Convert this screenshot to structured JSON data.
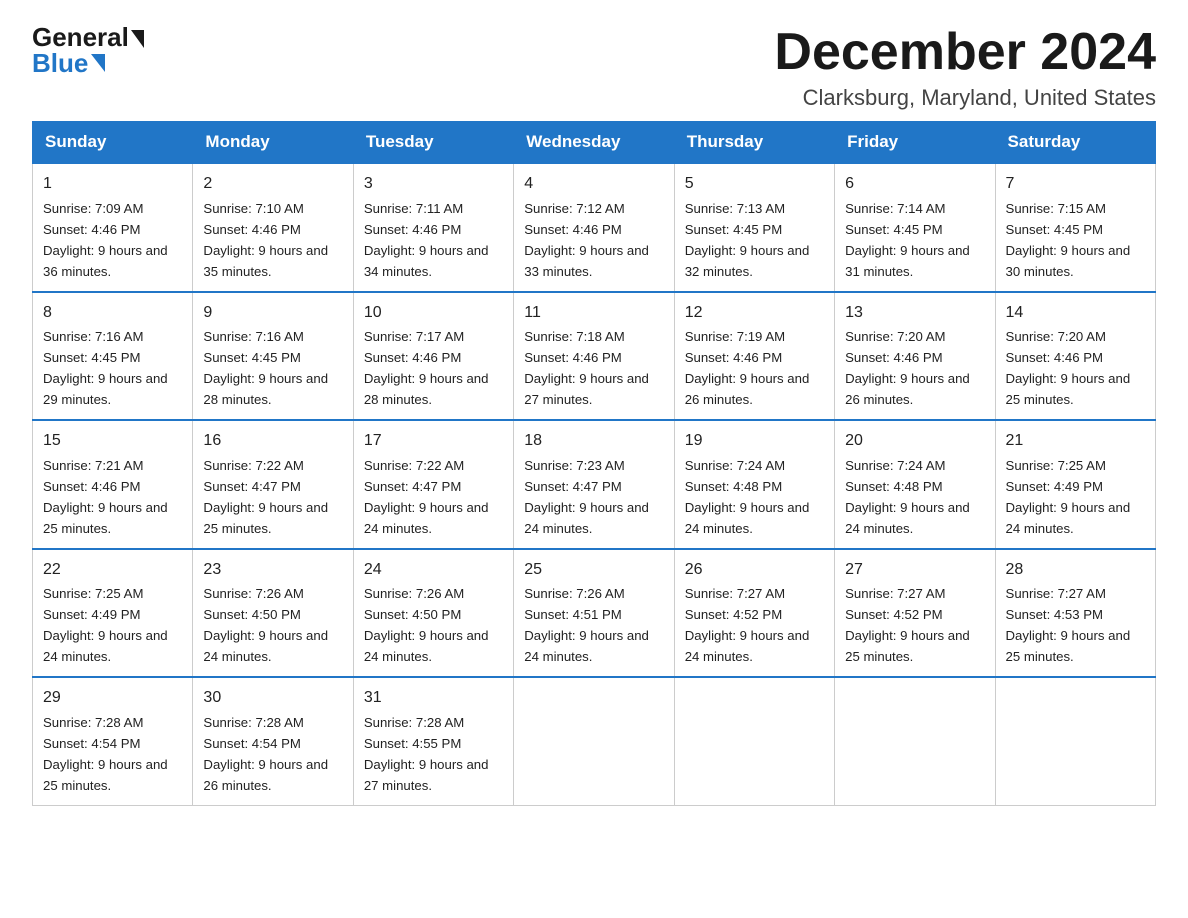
{
  "logo": {
    "general": "General",
    "blue": "Blue"
  },
  "title": "December 2024",
  "location": "Clarksburg, Maryland, United States",
  "days_of_week": [
    "Sunday",
    "Monday",
    "Tuesday",
    "Wednesday",
    "Thursday",
    "Friday",
    "Saturday"
  ],
  "weeks": [
    [
      {
        "day": "1",
        "sunrise": "7:09 AM",
        "sunset": "4:46 PM",
        "daylight": "9 hours and 36 minutes."
      },
      {
        "day": "2",
        "sunrise": "7:10 AM",
        "sunset": "4:46 PM",
        "daylight": "9 hours and 35 minutes."
      },
      {
        "day": "3",
        "sunrise": "7:11 AM",
        "sunset": "4:46 PM",
        "daylight": "9 hours and 34 minutes."
      },
      {
        "day": "4",
        "sunrise": "7:12 AM",
        "sunset": "4:46 PM",
        "daylight": "9 hours and 33 minutes."
      },
      {
        "day": "5",
        "sunrise": "7:13 AM",
        "sunset": "4:45 PM",
        "daylight": "9 hours and 32 minutes."
      },
      {
        "day": "6",
        "sunrise": "7:14 AM",
        "sunset": "4:45 PM",
        "daylight": "9 hours and 31 minutes."
      },
      {
        "day": "7",
        "sunrise": "7:15 AM",
        "sunset": "4:45 PM",
        "daylight": "9 hours and 30 minutes."
      }
    ],
    [
      {
        "day": "8",
        "sunrise": "7:16 AM",
        "sunset": "4:45 PM",
        "daylight": "9 hours and 29 minutes."
      },
      {
        "day": "9",
        "sunrise": "7:16 AM",
        "sunset": "4:45 PM",
        "daylight": "9 hours and 28 minutes."
      },
      {
        "day": "10",
        "sunrise": "7:17 AM",
        "sunset": "4:46 PM",
        "daylight": "9 hours and 28 minutes."
      },
      {
        "day": "11",
        "sunrise": "7:18 AM",
        "sunset": "4:46 PM",
        "daylight": "9 hours and 27 minutes."
      },
      {
        "day": "12",
        "sunrise": "7:19 AM",
        "sunset": "4:46 PM",
        "daylight": "9 hours and 26 minutes."
      },
      {
        "day": "13",
        "sunrise": "7:20 AM",
        "sunset": "4:46 PM",
        "daylight": "9 hours and 26 minutes."
      },
      {
        "day": "14",
        "sunrise": "7:20 AM",
        "sunset": "4:46 PM",
        "daylight": "9 hours and 25 minutes."
      }
    ],
    [
      {
        "day": "15",
        "sunrise": "7:21 AM",
        "sunset": "4:46 PM",
        "daylight": "9 hours and 25 minutes."
      },
      {
        "day": "16",
        "sunrise": "7:22 AM",
        "sunset": "4:47 PM",
        "daylight": "9 hours and 25 minutes."
      },
      {
        "day": "17",
        "sunrise": "7:22 AM",
        "sunset": "4:47 PM",
        "daylight": "9 hours and 24 minutes."
      },
      {
        "day": "18",
        "sunrise": "7:23 AM",
        "sunset": "4:47 PM",
        "daylight": "9 hours and 24 minutes."
      },
      {
        "day": "19",
        "sunrise": "7:24 AM",
        "sunset": "4:48 PM",
        "daylight": "9 hours and 24 minutes."
      },
      {
        "day": "20",
        "sunrise": "7:24 AM",
        "sunset": "4:48 PM",
        "daylight": "9 hours and 24 minutes."
      },
      {
        "day": "21",
        "sunrise": "7:25 AM",
        "sunset": "4:49 PM",
        "daylight": "9 hours and 24 minutes."
      }
    ],
    [
      {
        "day": "22",
        "sunrise": "7:25 AM",
        "sunset": "4:49 PM",
        "daylight": "9 hours and 24 minutes."
      },
      {
        "day": "23",
        "sunrise": "7:26 AM",
        "sunset": "4:50 PM",
        "daylight": "9 hours and 24 minutes."
      },
      {
        "day": "24",
        "sunrise": "7:26 AM",
        "sunset": "4:50 PM",
        "daylight": "9 hours and 24 minutes."
      },
      {
        "day": "25",
        "sunrise": "7:26 AM",
        "sunset": "4:51 PM",
        "daylight": "9 hours and 24 minutes."
      },
      {
        "day": "26",
        "sunrise": "7:27 AM",
        "sunset": "4:52 PM",
        "daylight": "9 hours and 24 minutes."
      },
      {
        "day": "27",
        "sunrise": "7:27 AM",
        "sunset": "4:52 PM",
        "daylight": "9 hours and 25 minutes."
      },
      {
        "day": "28",
        "sunrise": "7:27 AM",
        "sunset": "4:53 PM",
        "daylight": "9 hours and 25 minutes."
      }
    ],
    [
      {
        "day": "29",
        "sunrise": "7:28 AM",
        "sunset": "4:54 PM",
        "daylight": "9 hours and 25 minutes."
      },
      {
        "day": "30",
        "sunrise": "7:28 AM",
        "sunset": "4:54 PM",
        "daylight": "9 hours and 26 minutes."
      },
      {
        "day": "31",
        "sunrise": "7:28 AM",
        "sunset": "4:55 PM",
        "daylight": "9 hours and 27 minutes."
      },
      null,
      null,
      null,
      null
    ]
  ]
}
